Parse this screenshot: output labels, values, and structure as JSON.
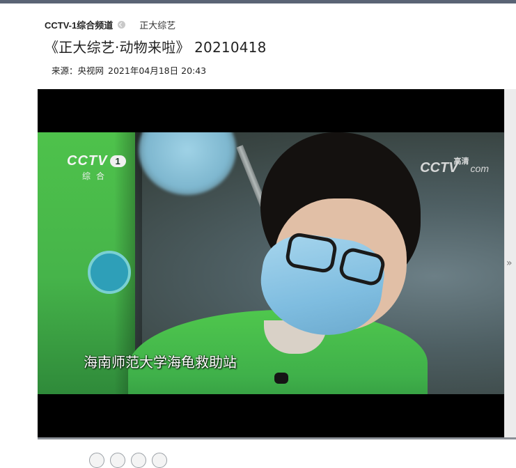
{
  "breadcrumb": {
    "channel": "CCTV-1综合频道",
    "section": "正大综艺"
  },
  "title": "《正大综艺·动物来啦》 20210418",
  "meta": {
    "source": "来源：央视网",
    "datetime": "2021年04月18日 20:43"
  },
  "video": {
    "channel_logo": "CCTV",
    "channel_number": "1",
    "channel_sub": "综合",
    "hd_logo": "CCTV",
    "hd_label": "高清",
    "hd_suffix": "com",
    "subtitle": "海南师范大学海龟救助站"
  },
  "side_panel": {
    "arrow_glyph": "»"
  },
  "colors": {
    "topbar": "#5a6475",
    "player_bg": "#000000",
    "shirt_green": "#46b44a"
  },
  "icons": [
    "chevron-icon",
    "expand-arrow-icon"
  ]
}
